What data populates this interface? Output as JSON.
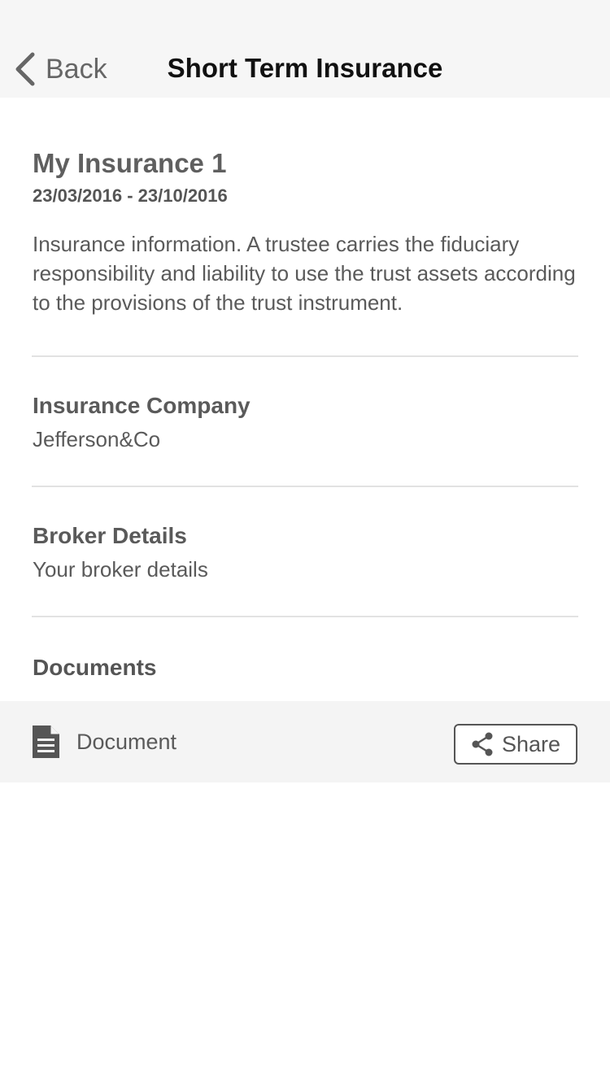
{
  "navbar": {
    "back_label": "Back",
    "title": "Short Term Insurance",
    "back_icon": "chevron-left-icon"
  },
  "policy": {
    "title": "My Insurance 1",
    "dates": "23/03/2016 - 23/10/2016",
    "description": "Insurance information. A trustee carries the fiduciary responsibility and liability to use the trust assets according to the provisions of the trust instrument."
  },
  "insurance_company": {
    "label": "Insurance Company",
    "value": "Jefferson&Co"
  },
  "broker": {
    "label": "Broker Details",
    "value": "Your broker details"
  },
  "documents": {
    "heading": "Documents",
    "items": [
      {
        "label": "Document",
        "icon": "document-icon",
        "share_label": "Share",
        "share_icon": "share-icon"
      }
    ]
  },
  "colors": {
    "navbar_bg": "#f6f6f6",
    "row_bg": "#f4f4f4",
    "text": "#5a5a5a",
    "title": "#111111"
  }
}
